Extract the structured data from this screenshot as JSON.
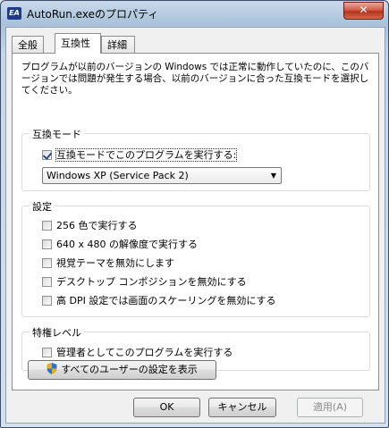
{
  "window": {
    "title": "AutoRun.exeのプロパティ",
    "app_icon_text": "EA",
    "close_glyph": "✕"
  },
  "tabs": [
    {
      "label": "全般"
    },
    {
      "label": "互換性"
    },
    {
      "label": "詳細"
    }
  ],
  "description": "プログラムが以前のバージョンの Windows では正常に動作していたのに、このバージョンでは問題が発生する場合、以前のバージョンに合った互換モードを選択してください。",
  "compat_mode": {
    "group_label": "互換モード",
    "checkbox_label": "互換モードでこのプログラムを実行する:",
    "checked": true,
    "selected_os": "Windows XP (Service Pack 2)"
  },
  "settings": {
    "group_label": "設定",
    "options": [
      {
        "label": "256 色で実行する",
        "checked": false
      },
      {
        "label": "640 x 480 の解像度で実行する",
        "checked": false
      },
      {
        "label": "視覚テーマを無効にします",
        "checked": false
      },
      {
        "label": "デスクトップ コンポジションを無効にする",
        "checked": false
      },
      {
        "label": "高 DPI 設定では画面のスケーリングを無効にする",
        "checked": false
      }
    ]
  },
  "privilege": {
    "group_label": "特権レベル",
    "option": {
      "label": "管理者としてこのプログラムを実行する",
      "checked": false
    }
  },
  "all_users_button": "すべてのユーザーの設定を表示",
  "buttons": {
    "ok": "OK",
    "cancel": "キャンセル",
    "apply": "適用(A)"
  }
}
